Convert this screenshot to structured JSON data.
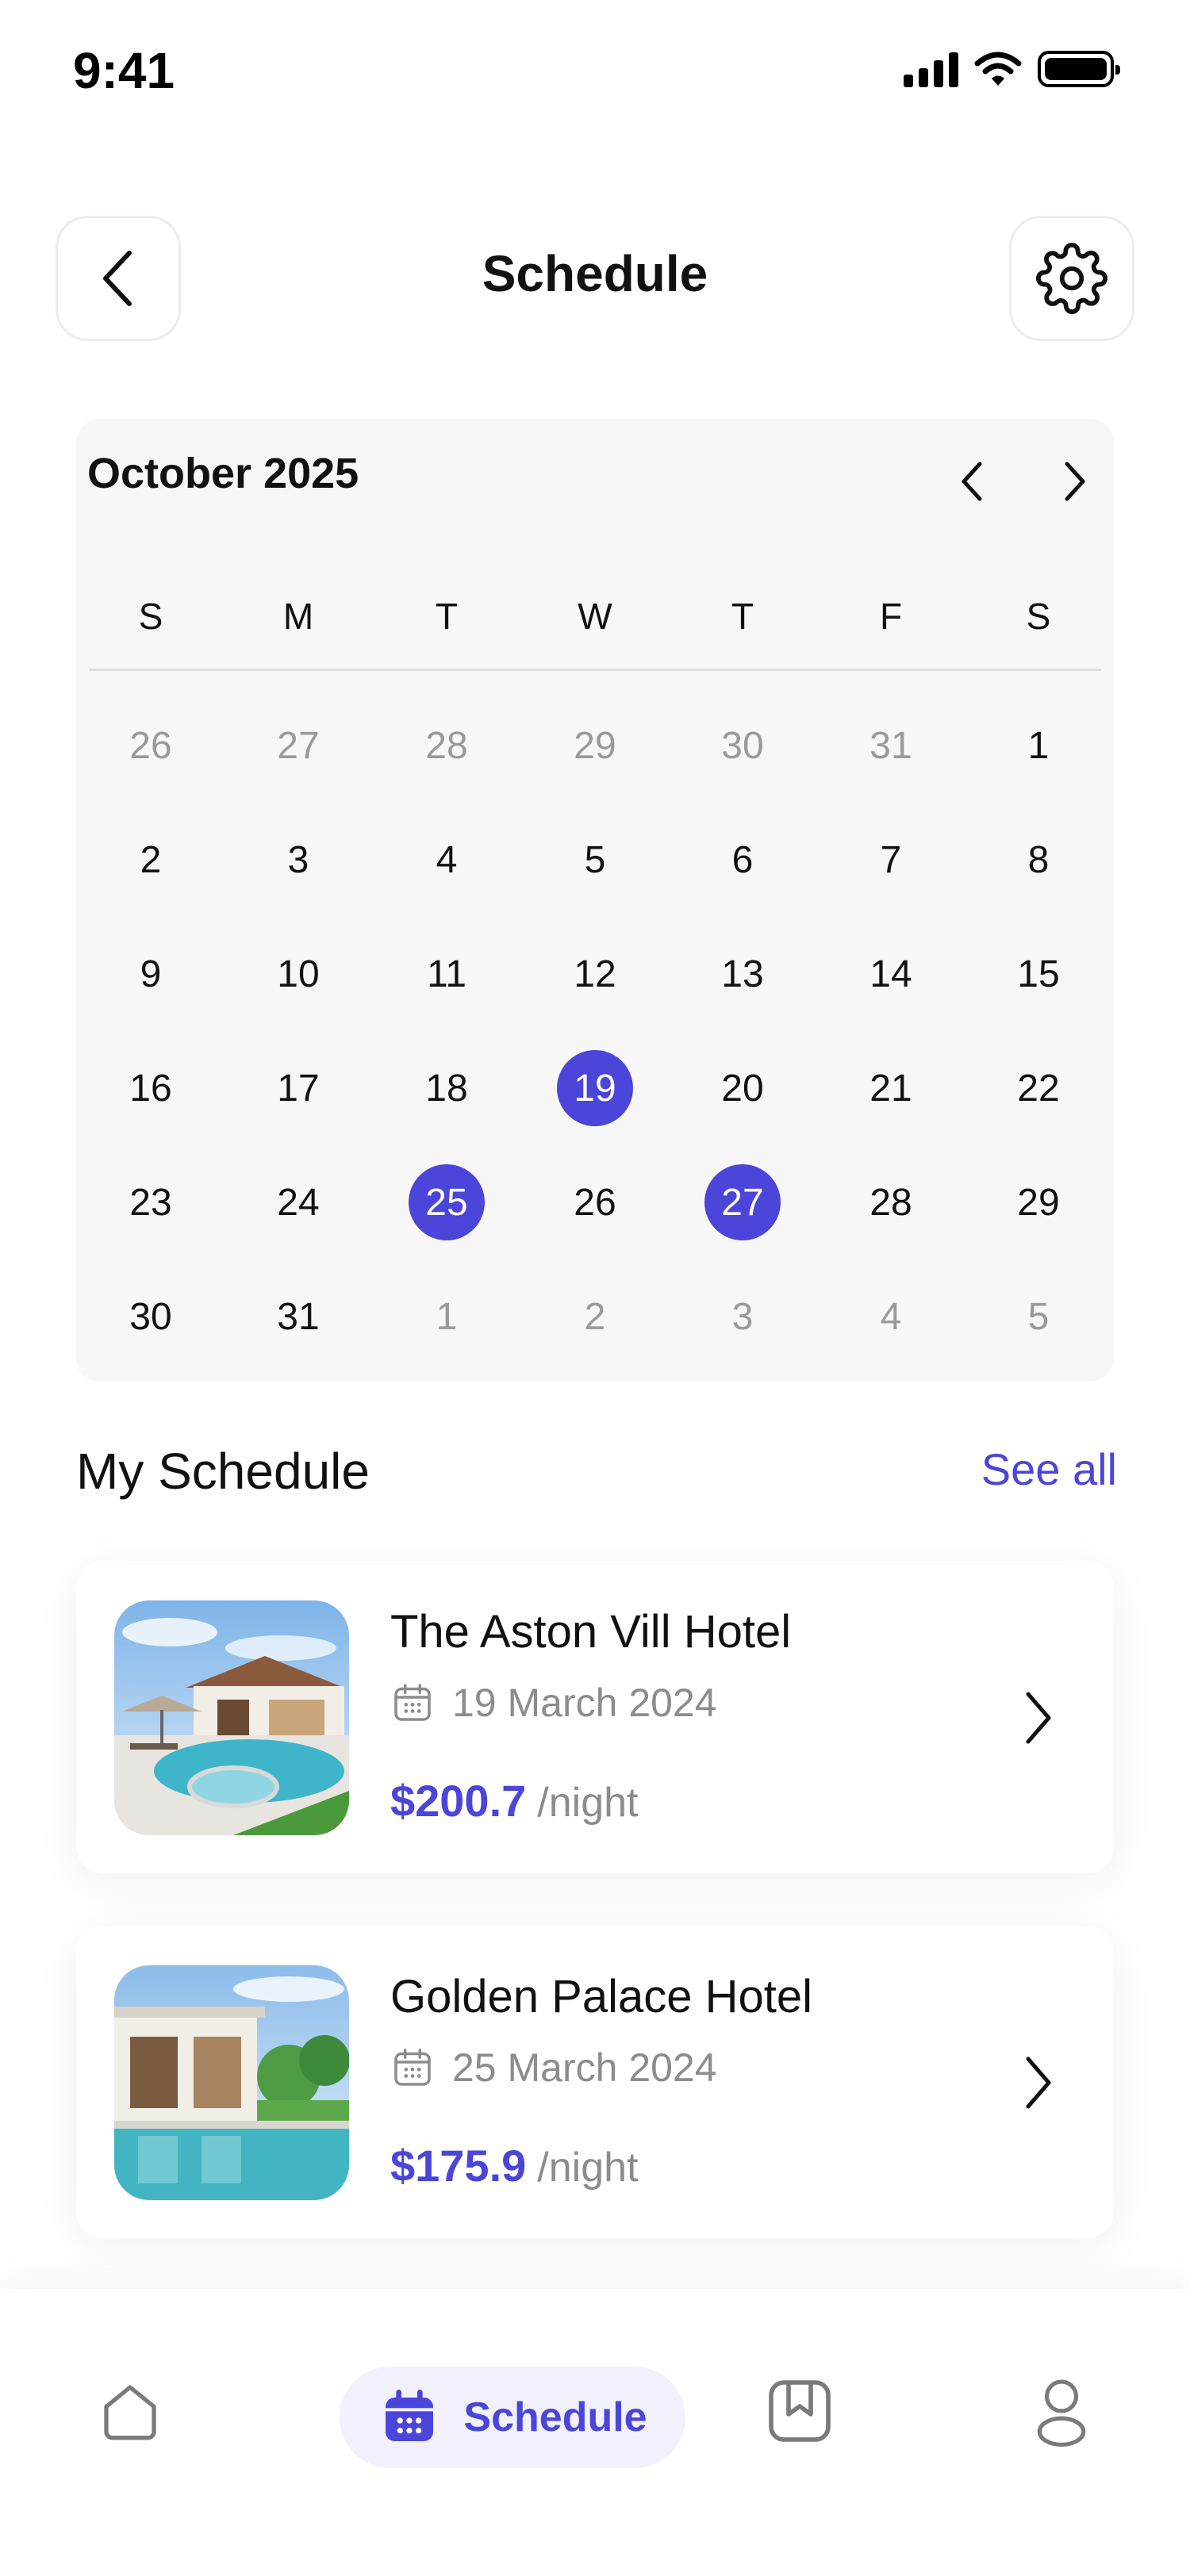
{
  "status_bar": {
    "time": "9:41"
  },
  "header": {
    "title": "Schedule",
    "back_icon": "chevron-left-icon",
    "settings_icon": "gear-icon"
  },
  "calendar": {
    "month_label": "October 2025",
    "weekdays": [
      "S",
      "M",
      "T",
      "W",
      "T",
      "F",
      "S"
    ],
    "weeks": [
      [
        "26",
        "27",
        "28",
        "29",
        "30",
        "31",
        "1"
      ],
      [
        "2",
        "3",
        "4",
        "5",
        "6",
        "7",
        "8"
      ],
      [
        "9",
        "10",
        "11",
        "12",
        "13",
        "14",
        "15"
      ],
      [
        "16",
        "17",
        "18",
        "19",
        "20",
        "21",
        "22"
      ],
      [
        "23",
        "24",
        "25",
        "26",
        "27",
        "28",
        "29"
      ],
      [
        "30",
        "31",
        "1",
        "2",
        "3",
        "4",
        "5"
      ]
    ],
    "selected_days": [
      "19",
      "25",
      "27"
    ],
    "accent_color": "#4b45d9",
    "muted_color": "#9a9a9a"
  },
  "my_schedule": {
    "title": "My Schedule",
    "see_all": "See all",
    "items": [
      {
        "name": "The Aston Vill Hotel",
        "date": "19 March 2024",
        "price": "$200.7",
        "unit": "/night"
      },
      {
        "name": "Golden Palace Hotel",
        "date": "25 March 2024",
        "price": "$175.9",
        "unit": "/night"
      }
    ]
  },
  "bottom_nav": {
    "items": [
      {
        "icon": "home-icon",
        "active": false
      },
      {
        "icon": "calendar-icon",
        "label": "Schedule",
        "active": true
      },
      {
        "icon": "bookmark-icon",
        "active": false
      },
      {
        "icon": "profile-icon",
        "active": false
      }
    ]
  }
}
